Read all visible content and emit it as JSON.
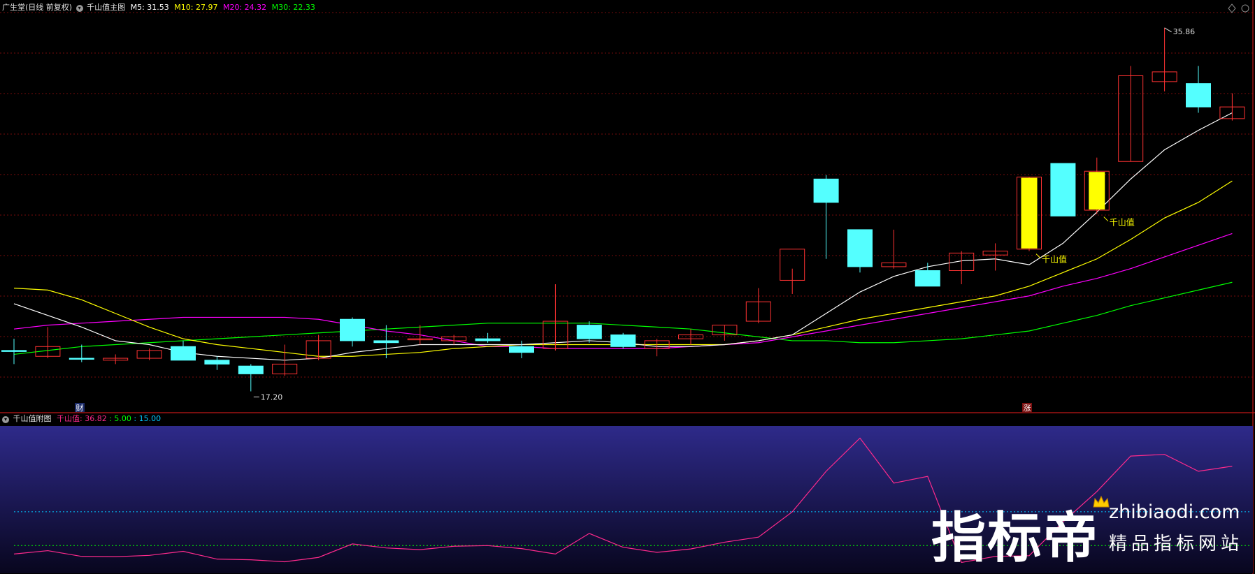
{
  "header": {
    "stock_label": "广生堂(日线 前复权)",
    "main_indicator_label": "千山值主图",
    "ma_readouts": [
      {
        "label": "M5: 31.53",
        "color": "#ffffff"
      },
      {
        "label": "M10: 27.97",
        "color": "#ffff00"
      },
      {
        "label": "M20: 24.32",
        "color": "#ff00ff"
      },
      {
        "label": "M30: 22.33",
        "color": "#00ff00"
      }
    ]
  },
  "sub_header": {
    "label": "千山值附图",
    "value_label": "千山值: 36.82",
    "level_a": ": 5.00",
    "level_b": ": 15.00"
  },
  "markers": {
    "low_price": "17.20",
    "high_price": "35.86",
    "signal_1": "千山值",
    "signal_2": "千山值",
    "tag_cai": "财",
    "tag_zhang": "涨"
  },
  "watermark": {
    "brand": "指标帝",
    "url": "zhibiaodi.com",
    "subtitle": "精品指标网站"
  },
  "colors": {
    "up": "#ff3232",
    "down": "#54ffff",
    "signal": "#ffff00",
    "ma5": "#ffffff",
    "ma10": "#ffff00",
    "ma20": "#ff00ff",
    "ma30": "#00ff00",
    "indicator": "#ff2a8c",
    "level_a": "#00ff00",
    "level_b": "#00c8ff",
    "grid": "#a01010"
  },
  "chart_data": {
    "type": "candlestick",
    "price_range": [
      16.5,
      36.5
    ],
    "candles": [
      {
        "o": 19.3,
        "h": 19.9,
        "l": 18.6,
        "c": 19.3,
        "dir": "flat"
      },
      {
        "o": 19.0,
        "h": 20.5,
        "l": 18.9,
        "c": 19.5,
        "dir": "up"
      },
      {
        "o": 18.9,
        "h": 19.6,
        "l": 18.7,
        "c": 18.9,
        "dir": "flat"
      },
      {
        "o": 18.9,
        "h": 19.1,
        "l": 18.6,
        "c": 18.8,
        "dir": "up"
      },
      {
        "o": 18.9,
        "h": 19.4,
        "l": 18.8,
        "c": 19.3,
        "dir": "up"
      },
      {
        "o": 19.5,
        "h": 19.8,
        "l": 18.8,
        "c": 18.8,
        "dir": "down"
      },
      {
        "o": 18.8,
        "h": 19.0,
        "l": 18.3,
        "c": 18.6,
        "dir": "down"
      },
      {
        "o": 18.5,
        "h": 18.6,
        "l": 17.2,
        "c": 18.1,
        "dir": "down"
      },
      {
        "o": 18.1,
        "h": 19.6,
        "l": 18.0,
        "c": 18.6,
        "dir": "up"
      },
      {
        "o": 18.9,
        "h": 20.1,
        "l": 18.8,
        "c": 19.8,
        "dir": "up"
      },
      {
        "o": 20.9,
        "h": 21.0,
        "l": 19.5,
        "c": 19.8,
        "dir": "down"
      },
      {
        "o": 19.8,
        "h": 20.6,
        "l": 18.9,
        "c": 19.7,
        "dir": "down"
      },
      {
        "o": 19.9,
        "h": 20.6,
        "l": 19.6,
        "c": 19.9,
        "dir": "up"
      },
      {
        "o": 19.8,
        "h": 20.1,
        "l": 19.6,
        "c": 20.0,
        "dir": "up"
      },
      {
        "o": 19.9,
        "h": 20.2,
        "l": 19.7,
        "c": 19.8,
        "dir": "down"
      },
      {
        "o": 19.5,
        "h": 19.8,
        "l": 18.9,
        "c": 19.2,
        "dir": "down"
      },
      {
        "o": 19.4,
        "h": 22.7,
        "l": 19.3,
        "c": 20.8,
        "dir": "up"
      },
      {
        "o": 20.6,
        "h": 20.8,
        "l": 19.7,
        "c": 19.9,
        "dir": "down"
      },
      {
        "o": 20.1,
        "h": 20.2,
        "l": 19.4,
        "c": 19.5,
        "dir": "down"
      },
      {
        "o": 19.8,
        "h": 19.9,
        "l": 19.0,
        "c": 19.4,
        "dir": "up"
      },
      {
        "o": 19.9,
        "h": 20.4,
        "l": 19.6,
        "c": 20.1,
        "dir": "up"
      },
      {
        "o": 20.1,
        "h": 20.6,
        "l": 19.8,
        "c": 20.6,
        "dir": "up"
      },
      {
        "o": 20.8,
        "h": 22.5,
        "l": 20.7,
        "c": 21.8,
        "dir": "up"
      },
      {
        "o": 22.9,
        "h": 23.5,
        "l": 22.2,
        "c": 24.5,
        "dir": "up"
      },
      {
        "o": 28.1,
        "h": 28.3,
        "l": 24.0,
        "c": 26.9,
        "dir": "down"
      },
      {
        "o": 25.5,
        "h": 25.5,
        "l": 23.3,
        "c": 23.6,
        "dir": "down"
      },
      {
        "o": 23.8,
        "h": 25.5,
        "l": 23.5,
        "c": 23.6,
        "dir": "up"
      },
      {
        "o": 23.4,
        "h": 23.8,
        "l": 22.6,
        "c": 22.6,
        "dir": "down"
      },
      {
        "o": 23.4,
        "h": 24.4,
        "l": 22.7,
        "c": 24.3,
        "dir": "up"
      },
      {
        "o": 24.2,
        "h": 24.8,
        "l": 23.4,
        "c": 24.4,
        "dir": "up"
      },
      {
        "o": 24.5,
        "h": 28.2,
        "l": 24.4,
        "c": 28.2,
        "dir": "signal"
      },
      {
        "o": 28.9,
        "h": 28.9,
        "l": 26.2,
        "c": 26.2,
        "dir": "down"
      },
      {
        "o": 26.5,
        "h": 29.2,
        "l": 26.3,
        "c": 28.5,
        "dir": "signal"
      },
      {
        "o": 29.0,
        "h": 33.9,
        "l": 29.0,
        "c": 33.4,
        "dir": "up"
      },
      {
        "o": 33.1,
        "h": 35.86,
        "l": 32.6,
        "c": 33.6,
        "dir": "up"
      },
      {
        "o": 33.0,
        "h": 33.9,
        "l": 31.5,
        "c": 31.8,
        "dir": "down"
      },
      {
        "o": 31.2,
        "h": 32.5,
        "l": 31.1,
        "c": 31.8,
        "dir": "up"
      }
    ],
    "ma5": [
      21.7,
      21.1,
      20.5,
      19.8,
      19.6,
      19.2,
      19.0,
      18.9,
      18.8,
      18.9,
      19.2,
      19.4,
      19.6,
      19.6,
      19.6,
      19.6,
      19.7,
      19.8,
      19.7,
      19.5,
      19.5,
      19.6,
      19.8,
      20.1,
      21.2,
      22.3,
      23.1,
      23.6,
      23.9,
      24.0,
      23.7,
      24.8,
      26.4,
      28.1,
      29.6,
      30.6,
      31.5
    ],
    "ma10": [
      22.5,
      22.4,
      21.9,
      21.2,
      20.5,
      19.9,
      19.6,
      19.4,
      19.2,
      19.0,
      19.0,
      19.1,
      19.2,
      19.4,
      19.5,
      19.6,
      19.6,
      19.6,
      19.6,
      19.6,
      19.6,
      19.6,
      19.8,
      20.1,
      20.5,
      20.9,
      21.2,
      21.5,
      21.8,
      22.1,
      22.6,
      23.3,
      24.0,
      25.0,
      26.1,
      26.9,
      28.0
    ],
    "ma20": [
      20.4,
      20.6,
      20.7,
      20.8,
      20.9,
      21.0,
      21.0,
      21.0,
      21.0,
      20.9,
      20.6,
      20.3,
      20.1,
      19.8,
      19.5,
      19.5,
      19.4,
      19.4,
      19.4,
      19.4,
      19.5,
      19.6,
      19.7,
      20.0,
      20.3,
      20.6,
      20.9,
      21.2,
      21.5,
      21.8,
      22.1,
      22.6,
      23.0,
      23.5,
      24.1,
      24.7,
      25.3
    ],
    "ma30": [
      19.1,
      19.3,
      19.5,
      19.6,
      19.7,
      19.8,
      19.9,
      20.0,
      20.1,
      20.2,
      20.3,
      20.4,
      20.5,
      20.6,
      20.7,
      20.7,
      20.7,
      20.7,
      20.6,
      20.5,
      20.4,
      20.2,
      20.0,
      19.8,
      19.8,
      19.7,
      19.7,
      19.8,
      19.9,
      20.1,
      20.3,
      20.7,
      21.1,
      21.6,
      22.0,
      22.4,
      22.8
    ],
    "indicator": {
      "name": "千山值",
      "range": [
        -3,
        40
      ],
      "levels": [
        5,
        15
      ],
      "values": [
        2.5,
        3.5,
        1.8,
        1.7,
        2.1,
        3.3,
        1.0,
        0.8,
        0.2,
        1.5,
        5.5,
        4.3,
        3.8,
        4.8,
        5.0,
        4.1,
        2.5,
        8.6,
        4.5,
        3.0,
        4.0,
        6.0,
        7.5,
        15.0,
        27.0,
        36.82,
        23.5,
        25.5,
        0.0,
        1.8,
        2.0,
        12.0,
        21.0,
        31.5,
        32.0,
        27.0,
        28.5
      ]
    }
  }
}
